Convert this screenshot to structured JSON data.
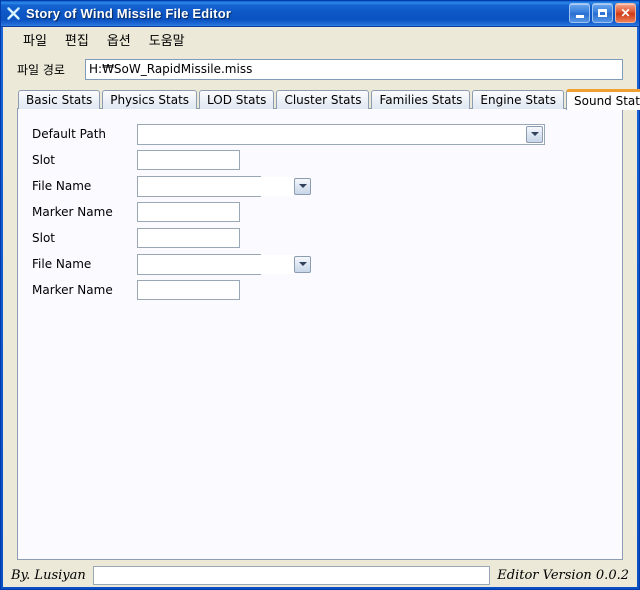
{
  "window": {
    "title": "Story of Wind Missile File Editor",
    "icon": "asterisk-icon",
    "caption": {
      "minimize_label": "Minimize",
      "maximize_label": "Maximize",
      "close_label": "✕"
    },
    "colors": {
      "titlebar_blue": "#0d57c6",
      "close_red": "#cf3a16",
      "active_tab_accent": "#f0a030",
      "panel_bg": "#fafaff",
      "client_bg": "#ece9d8"
    }
  },
  "menu": {
    "items": [
      {
        "label": "파일"
      },
      {
        "label": "편집"
      },
      {
        "label": "옵션"
      },
      {
        "label": "도움말"
      }
    ]
  },
  "path_row": {
    "label": "파일 경로",
    "value": "H:₩SoW_RapidMissile.miss",
    "placeholder": ""
  },
  "tabs": [
    {
      "label": "Basic Stats",
      "active": false
    },
    {
      "label": "Physics Stats",
      "active": false
    },
    {
      "label": "LOD Stats",
      "active": false
    },
    {
      "label": "Cluster Stats",
      "active": false
    },
    {
      "label": "Families Stats",
      "active": false
    },
    {
      "label": "Engine Stats",
      "active": false
    },
    {
      "label": "Sound Stats",
      "active": true
    }
  ],
  "sound_stats": {
    "fields": [
      {
        "label": "Default Path",
        "type": "combo",
        "value": "",
        "placeholder": "",
        "width": "w-default"
      },
      {
        "label": "Slot",
        "type": "text",
        "value": "",
        "placeholder": "",
        "width": "w-slot"
      },
      {
        "label": "File Name",
        "type": "combo",
        "value": "",
        "placeholder": "",
        "width": "w-file"
      },
      {
        "label": "Marker Name",
        "type": "text",
        "value": "",
        "placeholder": "",
        "width": "w-marker"
      },
      {
        "label": "Slot",
        "type": "text",
        "value": "",
        "placeholder": "",
        "width": "w-slot"
      },
      {
        "label": "File Name",
        "type": "combo",
        "value": "",
        "placeholder": "",
        "width": "w-file"
      },
      {
        "label": "Marker Name",
        "type": "text",
        "value": "",
        "placeholder": "",
        "width": "w-marker"
      }
    ]
  },
  "statusbar": {
    "author": "By. Lusiyan",
    "message": "",
    "message_placeholder": "",
    "version": "Editor Version 0.0.2"
  }
}
